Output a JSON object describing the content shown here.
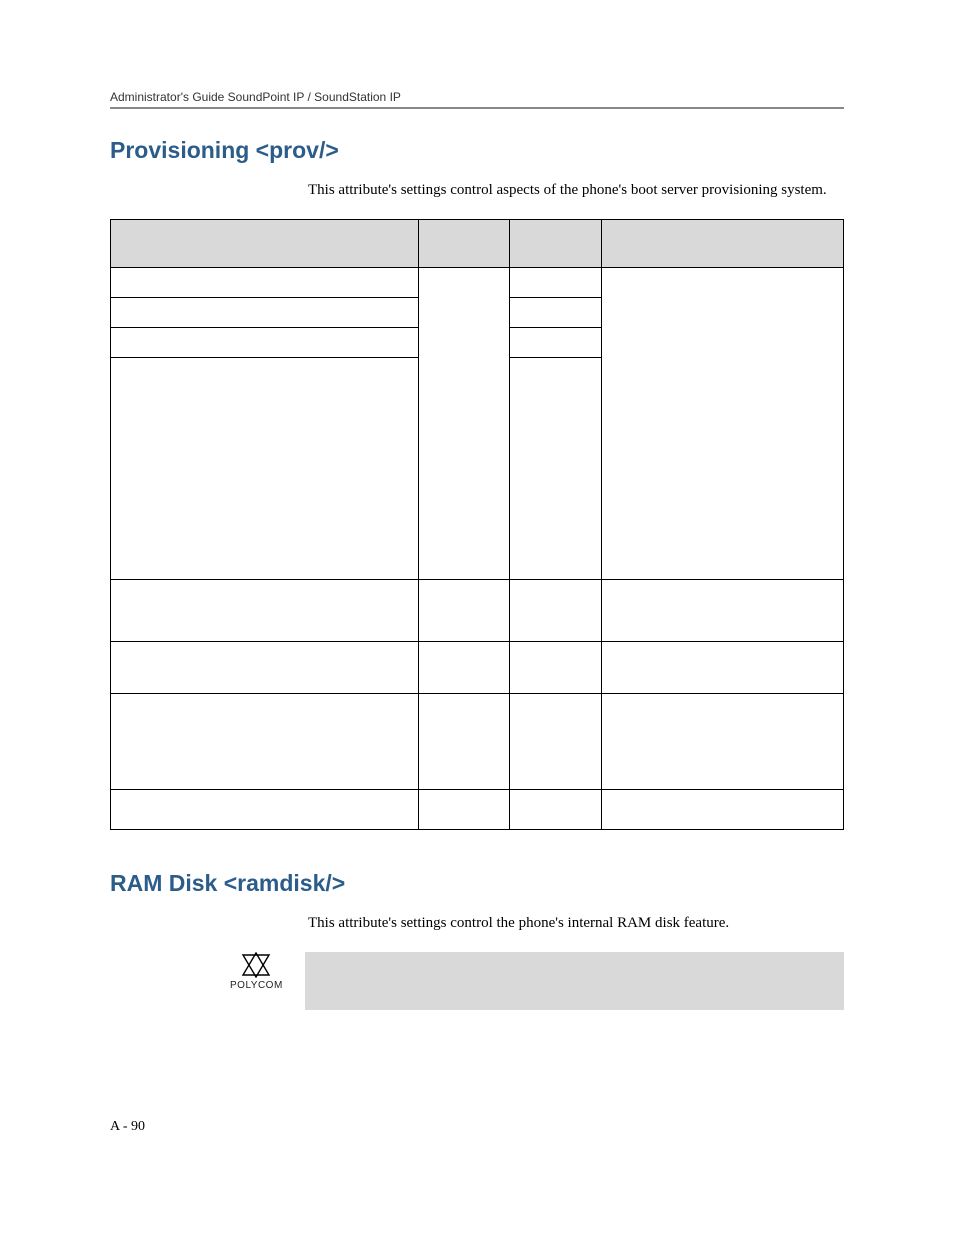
{
  "header": {
    "running": "Administrator's Guide SoundPoint IP / SoundStation IP"
  },
  "sections": {
    "provisioning": {
      "heading": "Provisioning <prov/>",
      "intro": "This attribute's settings control aspects of the phone's boot server provisioning system."
    },
    "ramdisk": {
      "heading": "RAM Disk <ramdisk/>",
      "intro": "This attribute's settings control the phone's internal RAM disk feature."
    }
  },
  "branding": {
    "logo_label": "POLYCOM"
  },
  "footer": {
    "page_number": "A - 90"
  }
}
